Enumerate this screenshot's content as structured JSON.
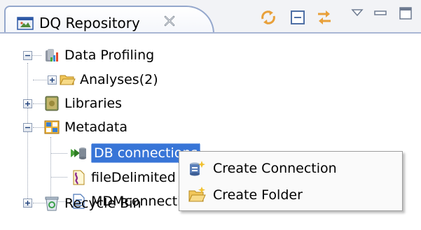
{
  "view": {
    "tab_title": "DQ Repository",
    "tab_icon": "repository-icon",
    "close_icon": "close-icon",
    "toolbar": [
      {
        "name": "refresh-icon"
      },
      {
        "name": "collapse-all-icon"
      },
      {
        "name": "link-with-editor-icon"
      },
      {
        "name": "view-menu-icon"
      },
      {
        "name": "minimize-icon"
      },
      {
        "name": "maximize-icon"
      }
    ]
  },
  "tree": {
    "data_profiling": {
      "label": "Data Profiling",
      "icon": "data-profiling-icon",
      "expanded": true
    },
    "analyses": {
      "label": "Analyses(2)",
      "icon": "folder-icon",
      "expanded": false
    },
    "libraries": {
      "label": "Libraries",
      "icon": "libraries-icon",
      "expanded": false
    },
    "metadata": {
      "label": "Metadata",
      "icon": "metadata-icon",
      "expanded": true
    },
    "db_connections": {
      "label": "DB connections",
      "icon": "db-connection-icon",
      "selected": true
    },
    "file_delimited": {
      "label": "fileDelimited",
      "icon": "file-delimited-icon"
    },
    "mdm_connections": {
      "label": "MDMconnections",
      "icon": "mdm-connection-icon"
    },
    "recycle_bin": {
      "label": "Recycle Bin",
      "icon": "recycle-bin-icon",
      "expanded": false
    }
  },
  "context_menu": {
    "items": [
      {
        "label": "Create Connection",
        "icon": "create-connection-icon"
      },
      {
        "label": "Create Folder",
        "icon": "create-folder-icon"
      }
    ]
  },
  "colors": {
    "selection": "#3875d7",
    "tab_border": "#94a7cc",
    "toolbar_arrows": "#e8a03a"
  }
}
